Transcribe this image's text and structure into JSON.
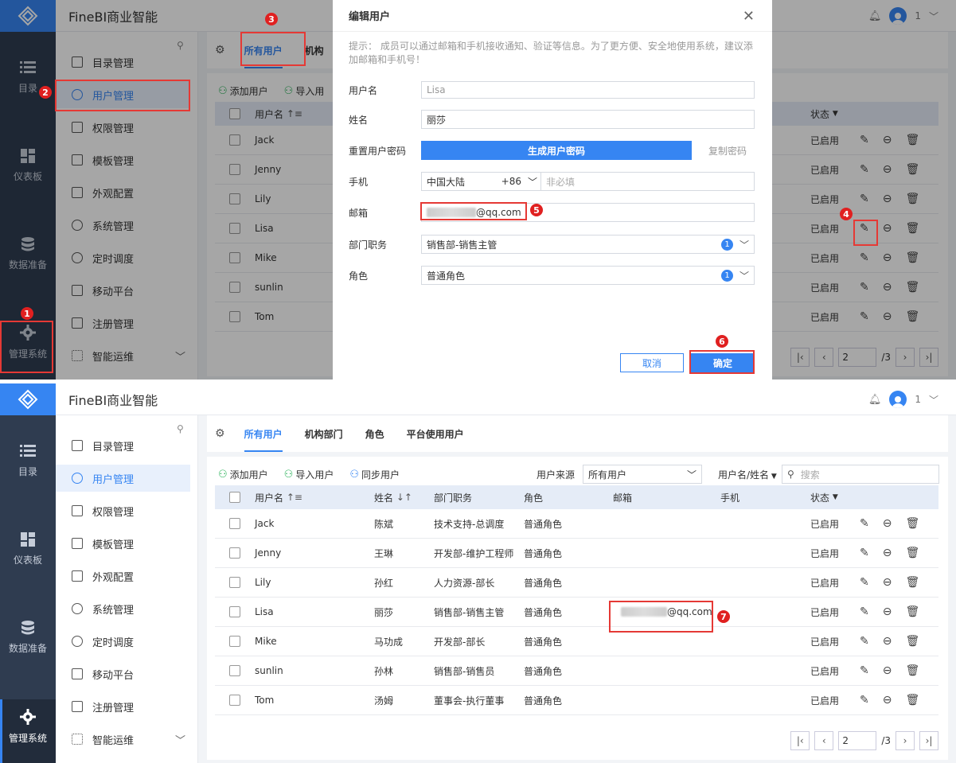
{
  "app": {
    "title": "FineBI商业智能",
    "user_count": "1"
  },
  "rail": [
    {
      "label": "目录",
      "icon": "list-icon"
    },
    {
      "label": "仪表板",
      "icon": "dashboard-icon"
    },
    {
      "label": "数据准备",
      "icon": "database-icon"
    },
    {
      "label": "管理系统",
      "icon": "gear-icon"
    }
  ],
  "menu": [
    {
      "label": "目录管理"
    },
    {
      "label": "用户管理"
    },
    {
      "label": "权限管理"
    },
    {
      "label": "模板管理"
    },
    {
      "label": "外观配置"
    },
    {
      "label": "系统管理"
    },
    {
      "label": "定时调度"
    },
    {
      "label": "移动平台"
    },
    {
      "label": "注册管理"
    },
    {
      "label": "智能运维"
    }
  ],
  "tabs": [
    {
      "label": "所有用户"
    },
    {
      "label": "机构部门"
    },
    {
      "label": "角色"
    },
    {
      "label": "平台使用用户"
    }
  ],
  "tab_top_partial": "机构",
  "toolbar": {
    "add": "添加用户",
    "import": "导入用户",
    "import_partial": "导入用",
    "sync": "同步用户",
    "source_label": "用户来源",
    "source_value": "所有用户",
    "search_by": "用户名/姓名",
    "search_placeholder": "搜索"
  },
  "columns": {
    "username": "用户名",
    "name": "姓名",
    "dept": "部门职务",
    "role": "角色",
    "email": "邮箱",
    "phone": "手机",
    "status": "状态"
  },
  "users": [
    {
      "username": "Jack",
      "name": "陈斌",
      "dept": "技术支持-总调度",
      "role": "普通角色",
      "email": "",
      "status": "已启用"
    },
    {
      "username": "Jenny",
      "name": "王琳",
      "dept": "开发部-维护工程师",
      "role": "普通角色",
      "email": "",
      "status": "已启用"
    },
    {
      "username": "Lily",
      "name": "孙红",
      "dept": "人力资源-部长",
      "role": "普通角色",
      "email": "",
      "status": "已启用"
    },
    {
      "username": "Lisa",
      "name": "丽莎",
      "dept": "销售部-销售主管",
      "role": "普通角色",
      "email": "@qq.com",
      "status": "已启用"
    },
    {
      "username": "Mike",
      "name": "马功成",
      "dept": "开发部-部长",
      "role": "普通角色",
      "email": "",
      "status": "已启用"
    },
    {
      "username": "sunlin",
      "name": "孙林",
      "dept": "销售部-销售员",
      "role": "普通角色",
      "email": "",
      "status": "已启用"
    },
    {
      "username": "Tom",
      "name": "汤姆",
      "dept": "董事会-执行董事",
      "role": "普通角色",
      "email": "",
      "status": "已启用"
    }
  ],
  "pager": {
    "page": "2",
    "total": "/3"
  },
  "dialog": {
    "title": "编辑用户",
    "tip": "提示： 成员可以通过邮箱和手机接收通知、验证等信息。为了更方便、安全地使用系统，建议添加邮箱和手机号！",
    "fields": {
      "username_label": "用户名",
      "username_value": "Lisa",
      "name_label": "姓名",
      "name_value": "丽莎",
      "reset_label": "重置用户密码",
      "generate_btn": "生成用户密码",
      "copy_btn": "复制密码",
      "phone_label": "手机",
      "region": "中国大陆",
      "code": "+86",
      "phone_placeholder": "非必填",
      "email_label": "邮箱",
      "email_value": "@qq.com",
      "dept_label": "部门职务",
      "dept_value": "销售部-销售主管",
      "dept_count": "1",
      "role_label": "角色",
      "role_value": "普通角色",
      "role_count": "1"
    },
    "cancel": "取消",
    "confirm": "确定"
  },
  "markers": [
    "1",
    "2",
    "3",
    "4",
    "5",
    "6",
    "7"
  ],
  "colors": {
    "accent": "#3685f2",
    "rail": "#2f3c50",
    "marker": "#e02020"
  }
}
